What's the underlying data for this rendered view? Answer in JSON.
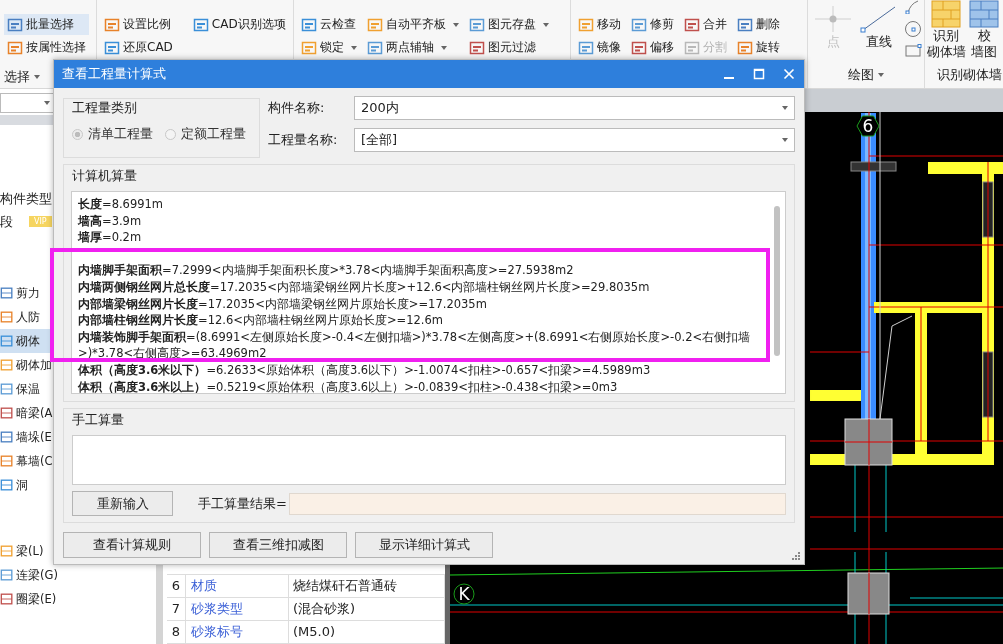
{
  "ribbon": {
    "groups": [
      {
        "kind": "tools",
        "label": "选择",
        "label_dropdown": true,
        "columns": [
          [
            {
              "label": "批量选择",
              "selected": true,
              "disabled": false,
              "dropdown": false
            },
            {
              "label": "按属性选择",
              "selected": false,
              "disabled": false,
              "dropdown": false
            }
          ]
        ]
      },
      {
        "kind": "tools",
        "columns": [
          [
            {
              "label": "设置比例",
              "selected": false,
              "disabled": false,
              "dropdown": false
            },
            {
              "label": "还原CAD",
              "selected": false,
              "disabled": false,
              "dropdown": false
            }
          ],
          [
            {
              "label": "CAD识别选项",
              "selected": false,
              "disabled": false,
              "dropdown": false
            }
          ]
        ]
      },
      {
        "kind": "tools",
        "columns": [
          [
            {
              "label": "云检查",
              "selected": false,
              "disabled": false,
              "dropdown": false
            },
            {
              "label": "锁定",
              "selected": false,
              "disabled": false,
              "dropdown": true
            }
          ],
          [
            {
              "label": "自动平齐板",
              "selected": false,
              "disabled": false,
              "dropdown": true
            },
            {
              "label": "两点辅轴",
              "selected": false,
              "disabled": false,
              "dropdown": true
            }
          ],
          [
            {
              "label": "图元存盘",
              "selected": false,
              "disabled": false,
              "dropdown": true
            },
            {
              "label": "图元过滤",
              "selected": false,
              "disabled": false,
              "dropdown": false
            }
          ]
        ]
      },
      {
        "kind": "tools",
        "columns": [
          [
            {
              "label": "移动",
              "selected": false,
              "disabled": false,
              "dropdown": false
            },
            {
              "label": "镜像",
              "selected": false,
              "disabled": false,
              "dropdown": false
            }
          ],
          [
            {
              "label": "修剪",
              "selected": false,
              "disabled": false,
              "dropdown": false
            },
            {
              "label": "偏移",
              "selected": false,
              "disabled": false,
              "dropdown": false
            }
          ],
          [
            {
              "label": "合并",
              "selected": false,
              "disabled": false,
              "dropdown": false
            },
            {
              "label": "分割",
              "selected": false,
              "disabled": true,
              "dropdown": false
            }
          ],
          [
            {
              "label": "删除",
              "selected": false,
              "disabled": false,
              "dropdown": false
            },
            {
              "label": "旋转",
              "selected": false,
              "disabled": false,
              "dropdown": false
            }
          ]
        ]
      },
      {
        "kind": "draw",
        "label": "绘图",
        "label_dropdown": true,
        "items": [
          {
            "label": "点",
            "disabled": true
          },
          {
            "label": "直线",
            "disabled": false
          }
        ]
      },
      {
        "kind": "large",
        "label": "识别砌体墙",
        "label_dropdown": false,
        "items": [
          {
            "lines": [
              "识别",
              "砌体墙"
            ]
          },
          {
            "lines": [
              "校",
              "墙图"
            ]
          }
        ]
      }
    ]
  },
  "left_panel": {
    "rows": [
      {
        "label": "构件类型"
      },
      {
        "label": "段",
        "badge": "VIP"
      }
    ],
    "tree": [
      [
        {
          "label": "剪力",
          "selected": false
        },
        {
          "label": "人防",
          "selected": false
        },
        {
          "label": "砌体",
          "selected": true
        },
        {
          "label": "砌体加",
          "selected": false
        },
        {
          "label": "保温",
          "selected": false
        },
        {
          "label": "暗梁(A",
          "selected": false
        },
        {
          "label": "墙垛(E",
          "selected": false
        },
        {
          "label": "幕墙(C",
          "selected": false
        },
        {
          "label": "洞",
          "selected": false
        }
      ],
      [
        {
          "label": "梁(L)",
          "selected": false
        },
        {
          "label": "连梁(G)",
          "selected": false
        },
        {
          "label": "圈梁(E)",
          "selected": false
        }
      ]
    ]
  },
  "properties": {
    "rows": [
      {
        "num": "6",
        "name": "材质",
        "value": "烧结煤矸石普通砖"
      },
      {
        "num": "7",
        "name": "砂浆类型",
        "value": "(混合砂浆)"
      },
      {
        "num": "8",
        "name": "砂浆标号",
        "value": "(M5.0)"
      }
    ]
  },
  "cad": {
    "axis_labels": [
      {
        "kind": "hexagon",
        "text": "6"
      },
      {
        "kind": "circle",
        "text": "K"
      }
    ]
  },
  "dialog": {
    "title": "查看工程量计算式",
    "category": {
      "title": "工程量类别",
      "options": [
        {
          "label": "清单工程量",
          "selected": true
        },
        {
          "label": "定额工程量",
          "selected": false
        }
      ]
    },
    "fields": [
      {
        "label": "构件名称:",
        "value": "200内"
      },
      {
        "label": "工程量名称:",
        "value": "[全部]"
      }
    ],
    "computed": {
      "title": "计算机算量",
      "lines": [
        "**长度**=8.6991m",
        "**墙高**=3.9m",
        "**墙厚**=0.2m"
      ],
      "lines_below_mark": [
        "**内墙脚手架面积**=7.2999<内墙脚手架面积长度>*3.78<内墙脚手架面积高度>=27.5938m2",
        "**内墙两侧钢丝网片总长度**=17.2035<内部墙梁钢丝网片长度>+12.6<内部墙柱钢丝网片长度>=29.8035m",
        "**内部墙梁钢丝网片长度**=17.2035<内部墙梁钢丝网片原始长度>=17.2035m",
        "**内部墙柱钢丝网片长度**=12.6<内部墙柱钢丝网片原始长度>=12.6m",
        "**内墙装饰脚手架面积**=(8.6991<左侧原始长度>-0.4<左侧扣墙>)*3.78<左侧高度>+(8.6991<右侧原始长度>-0.2<右侧扣墙>)*3.78<右侧高度>=63.4969m2",
        "**体积（高度3.6米以下）**=6.2633<原始体积（高度3.6以下）>-1.0074<扣柱>-0.657<扣梁>=4.5989m3",
        "**体积（高度3.6米以上）**=0.5219<原始体积（高度3.6以上）>-0.0839<扣柱>-0.438<扣梁>=0m3"
      ]
    },
    "manual": {
      "title": "手工算量",
      "button": "重新输入",
      "result_label": "手工算量结果="
    },
    "buttons": [
      "查看计算规则",
      "查看三维扣减图",
      "显示详细计算式"
    ]
  }
}
